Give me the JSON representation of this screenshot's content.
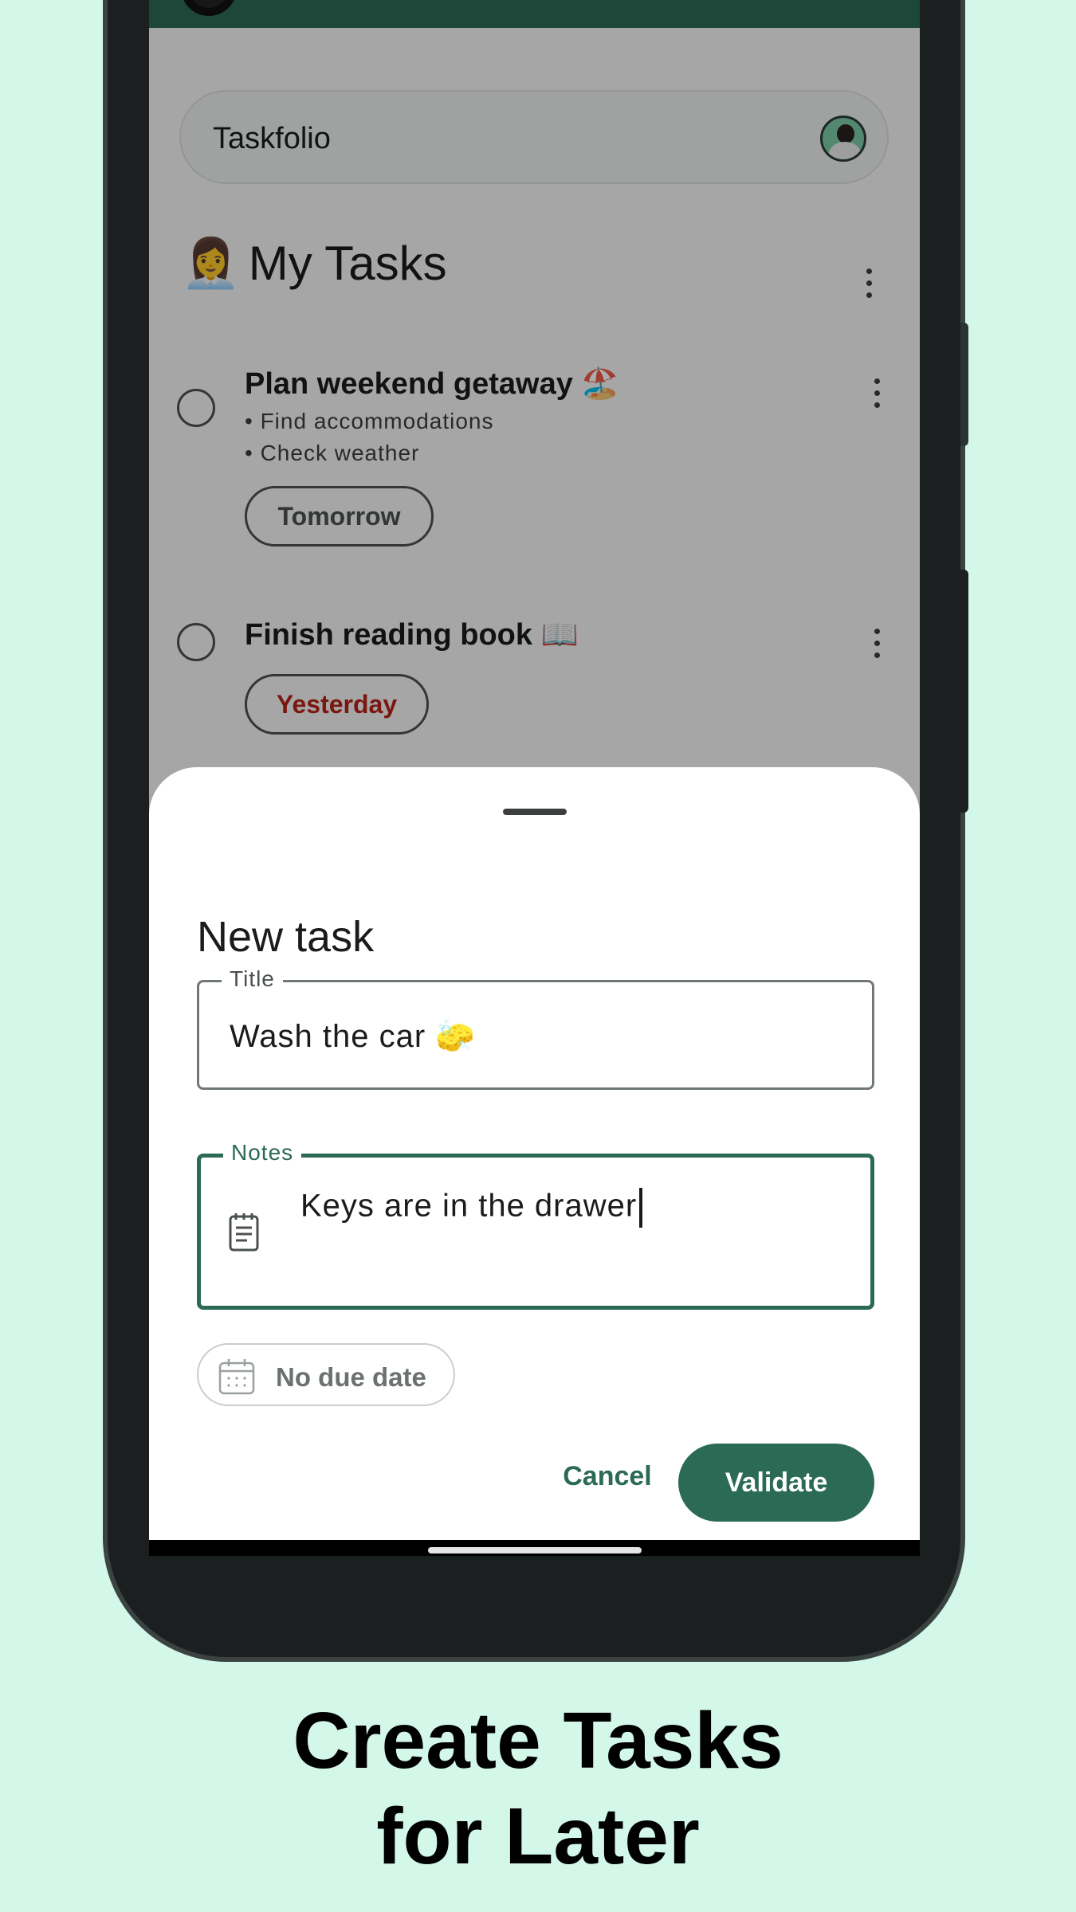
{
  "app": {
    "name": "Taskfolio"
  },
  "list": {
    "title_emoji": "👩‍💼",
    "title": "My Tasks",
    "tasks": [
      {
        "title": "Plan weekend getaway 🏖️",
        "notes": [
          "• Find accommodations",
          "• Check weather"
        ],
        "due": "Tomorrow",
        "overdue": false
      },
      {
        "title": "Finish reading book 📖",
        "notes": [],
        "due": "Yesterday",
        "overdue": true
      }
    ]
  },
  "sheet": {
    "title": "New task",
    "title_field": {
      "label": "Title",
      "value": "Wash the car 🧽"
    },
    "notes_field": {
      "label": "Notes",
      "value": "Keys are in the drawer"
    },
    "due_date_chip": "No due date",
    "cancel_label": "Cancel",
    "validate_label": "Validate"
  },
  "caption": {
    "line1": "Create Tasks",
    "line2": "for Later"
  },
  "colors": {
    "background": "#d3f7e9",
    "primary": "#2b6a54",
    "overdue": "#b42318"
  },
  "icons": [
    "avatar",
    "more-vert-icon",
    "notes-icon",
    "calendar-icon"
  ]
}
